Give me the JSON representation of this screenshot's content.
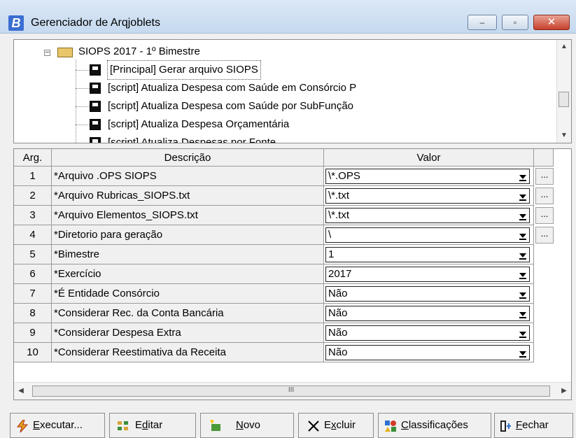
{
  "window": {
    "title": "Gerenciador de Arqjoblets",
    "icon_letter": "B",
    "minimize": "–",
    "maximize": "▫",
    "close": "✕"
  },
  "tree": {
    "root": "SIOPS 2017 - 1º Bimestre",
    "items": [
      "[Principal] Gerar arquivo SIOPS",
      "[script] Atualiza Despesa com Saúde em Consórcio P",
      "[script] Atualiza Despesa com Saúde por SubFunção",
      "[script] Atualiza Despesa Orçamentária",
      "[script] Atualiza Despesas por Fonte"
    ]
  },
  "grid": {
    "headers": {
      "arg": "Arg.",
      "desc": "Descrição",
      "valor": "Valor"
    },
    "rows": [
      {
        "n": "1",
        "desc": "*Arquivo .OPS SIOPS",
        "value": "\\*.OPS",
        "ellipsis": "..."
      },
      {
        "n": "2",
        "desc": "*Arquivo Rubricas_SIOPS.txt",
        "value": "\\*.txt",
        "ellipsis": "..."
      },
      {
        "n": "3",
        "desc": "*Arquivo Elementos_SIOPS.txt",
        "value": "\\*.txt",
        "ellipsis": "..."
      },
      {
        "n": "4",
        "desc": "*Diretorio para geração",
        "value": "\\",
        "ellipsis": "..."
      },
      {
        "n": "5",
        "desc": "*Bimestre",
        "value": "1"
      },
      {
        "n": "6",
        "desc": "*Exercício",
        "value": "2017"
      },
      {
        "n": "7",
        "desc": "*É Entidade Consórcio",
        "value": "Não"
      },
      {
        "n": "8",
        "desc": "*Considerar Rec. da Conta Bancária",
        "value": "Não"
      },
      {
        "n": "9",
        "desc": "*Considerar Despesa Extra",
        "value": "Não"
      },
      {
        "n": "10",
        "desc": "*Considerar Reestimativa da Receita",
        "value": "Não"
      }
    ],
    "hscroll_grip": "III"
  },
  "toolbar": {
    "executar": {
      "u": "E",
      "rest": "xecutar..."
    },
    "editar": {
      "pre": "E",
      "u": "d",
      "rest": "itar"
    },
    "novo": {
      "u": "N",
      "rest": "ovo"
    },
    "excluir": {
      "pre": "E",
      "u": "x",
      "rest": "cluir"
    },
    "classificacoes": {
      "u": "C",
      "rest": "lassificações"
    },
    "fechar": {
      "u": "F",
      "rest": "echar"
    }
  },
  "colors": {
    "titlebar": "#c5d9ef",
    "close": "#c6412b",
    "folder": "#e8c66a"
  }
}
